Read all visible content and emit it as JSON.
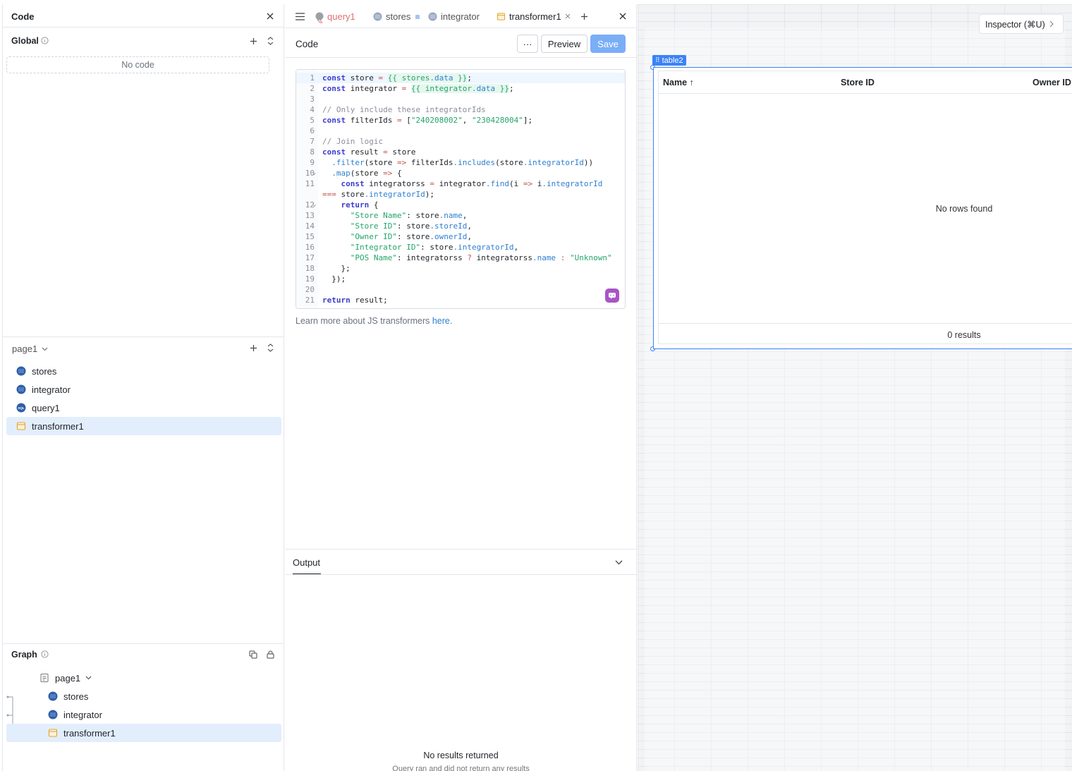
{
  "left": {
    "code_title": "Code",
    "global_label": "Global",
    "no_code": "No code",
    "page_label": "page1",
    "items": [
      {
        "label": "stores",
        "icon": "database-icon"
      },
      {
        "label": "integrator",
        "icon": "database-icon"
      },
      {
        "label": "query1",
        "icon": "sql-icon"
      },
      {
        "label": "transformer1",
        "icon": "transformer-icon"
      }
    ],
    "graph_label": "Graph",
    "graph_items": [
      {
        "label": "page1"
      },
      {
        "label": "stores"
      },
      {
        "label": "integrator"
      },
      {
        "label": "transformer1"
      }
    ]
  },
  "center": {
    "tabs": [
      {
        "label": "query1"
      },
      {
        "label": "stores"
      },
      {
        "label": "integrator"
      },
      {
        "label": "transformer1"
      }
    ],
    "code_label": "Code",
    "more_label": "···",
    "preview_label": "Preview",
    "save_label": "Save",
    "learn_text": "Learn more about JS transformers ",
    "learn_link": "here.",
    "output_label": "Output",
    "no_results": "No results returned",
    "no_results_sub": "Query ran and did not return any results"
  },
  "right": {
    "inspector_label": "Inspector (⌘U)",
    "table_tag": "table2",
    "columns": [
      "Name",
      "Store ID",
      "Owner ID"
    ],
    "sort_arrow": "↑",
    "no_rows": "No rows found",
    "results": "0 results"
  },
  "colors": {
    "accent": "#3b82f6",
    "save": "#7aaef7",
    "selected": "#e3eefc"
  }
}
